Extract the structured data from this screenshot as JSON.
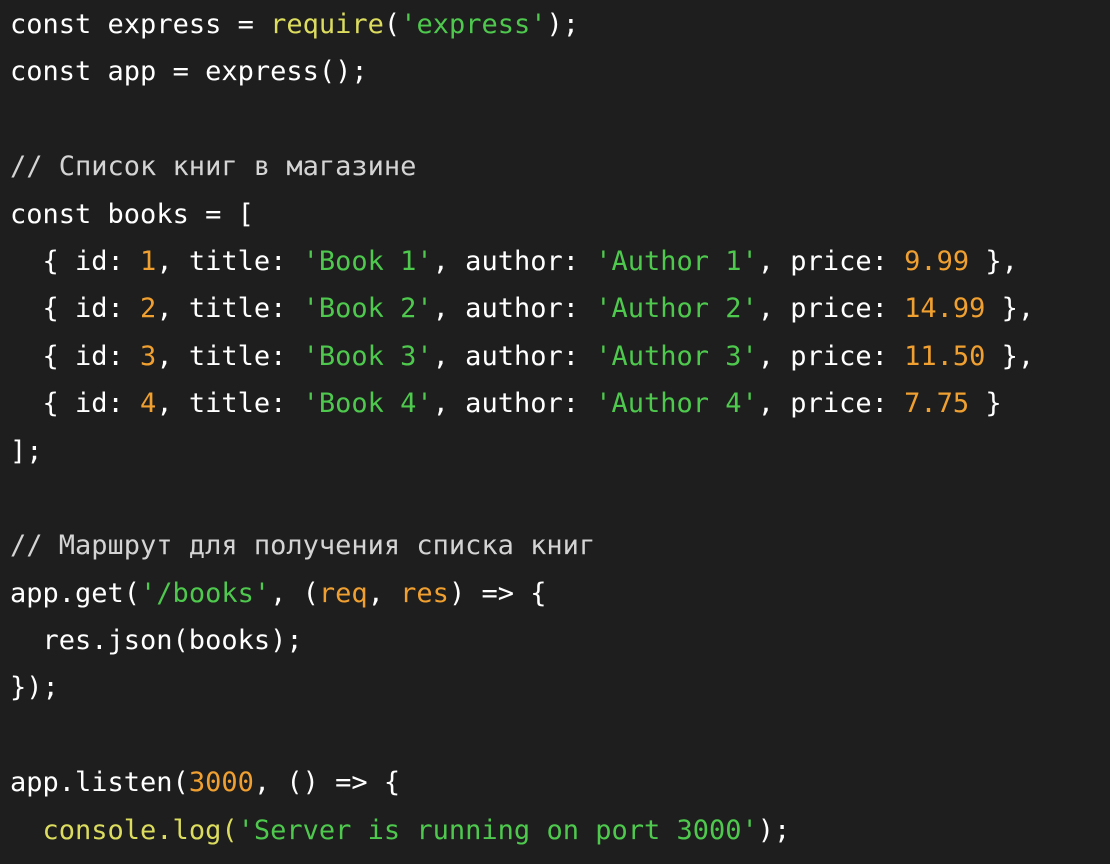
{
  "colors": {
    "background": "#1e1e1e",
    "plain": "#ffffff",
    "keyword": "#ffffff",
    "identifier": "#ffffff",
    "function": "#ffffff",
    "require": "#dcdc5f",
    "string": "#4ec94e",
    "number": "#f0a030",
    "comment": "#d4d4d4",
    "param": "#f0a030",
    "call": "#dcdc5f",
    "punct": "#ffffff"
  },
  "editor": {
    "lines": [
      [
        {
          "text": "const ",
          "type": "keyword"
        },
        {
          "text": "express",
          "type": "identifier"
        },
        {
          "text": " = ",
          "type": "punct"
        },
        {
          "text": "require",
          "type": "require"
        },
        {
          "text": "(",
          "type": "punct"
        },
        {
          "text": "'express'",
          "type": "string"
        },
        {
          "text": ");",
          "type": "punct"
        }
      ],
      [
        {
          "text": "const ",
          "type": "keyword"
        },
        {
          "text": "app",
          "type": "identifier"
        },
        {
          "text": " = ",
          "type": "punct"
        },
        {
          "text": "express",
          "type": "function"
        },
        {
          "text": "();",
          "type": "punct"
        }
      ],
      [],
      [
        {
          "text": "// Список книг в магазине",
          "type": "comment"
        }
      ],
      [
        {
          "text": "const ",
          "type": "keyword"
        },
        {
          "text": "books",
          "type": "identifier"
        },
        {
          "text": " = [",
          "type": "punct"
        }
      ],
      [
        {
          "text": "  { id: ",
          "type": "punct"
        },
        {
          "text": "1",
          "type": "number"
        },
        {
          "text": ", title: ",
          "type": "punct"
        },
        {
          "text": "'Book 1'",
          "type": "string"
        },
        {
          "text": ", author: ",
          "type": "punct"
        },
        {
          "text": "'Author 1'",
          "type": "string"
        },
        {
          "text": ", price: ",
          "type": "punct"
        },
        {
          "text": "9.99",
          "type": "number"
        },
        {
          "text": " },",
          "type": "punct"
        }
      ],
      [
        {
          "text": "  { id: ",
          "type": "punct"
        },
        {
          "text": "2",
          "type": "number"
        },
        {
          "text": ", title: ",
          "type": "punct"
        },
        {
          "text": "'Book 2'",
          "type": "string"
        },
        {
          "text": ", author: ",
          "type": "punct"
        },
        {
          "text": "'Author 2'",
          "type": "string"
        },
        {
          "text": ", price: ",
          "type": "punct"
        },
        {
          "text": "14.99",
          "type": "number"
        },
        {
          "text": " },",
          "type": "punct"
        }
      ],
      [
        {
          "text": "  { id: ",
          "type": "punct"
        },
        {
          "text": "3",
          "type": "number"
        },
        {
          "text": ", title: ",
          "type": "punct"
        },
        {
          "text": "'Book 3'",
          "type": "string"
        },
        {
          "text": ", author: ",
          "type": "punct"
        },
        {
          "text": "'Author 3'",
          "type": "string"
        },
        {
          "text": ", price: ",
          "type": "punct"
        },
        {
          "text": "11.50",
          "type": "number"
        },
        {
          "text": " },",
          "type": "punct"
        }
      ],
      [
        {
          "text": "  { id: ",
          "type": "punct"
        },
        {
          "text": "4",
          "type": "number"
        },
        {
          "text": ", title: ",
          "type": "punct"
        },
        {
          "text": "'Book 4'",
          "type": "string"
        },
        {
          "text": ", author: ",
          "type": "punct"
        },
        {
          "text": "'Author 4'",
          "type": "string"
        },
        {
          "text": ", price: ",
          "type": "punct"
        },
        {
          "text": "7.75",
          "type": "number"
        },
        {
          "text": " }",
          "type": "punct"
        }
      ],
      [
        {
          "text": "];",
          "type": "punct"
        }
      ],
      [],
      [
        {
          "text": "// Маршрут для получения списка книг",
          "type": "comment"
        }
      ],
      [
        {
          "text": "app.get(",
          "type": "punct"
        },
        {
          "text": "'/books'",
          "type": "string"
        },
        {
          "text": ", (",
          "type": "punct"
        },
        {
          "text": "req",
          "type": "param"
        },
        {
          "text": ", ",
          "type": "punct"
        },
        {
          "text": "res",
          "type": "param"
        },
        {
          "text": ") => {",
          "type": "punct"
        }
      ],
      [
        {
          "text": "  res.json(books);",
          "type": "punct"
        }
      ],
      [
        {
          "text": "});",
          "type": "punct"
        }
      ],
      [],
      [
        {
          "text": "app.listen(",
          "type": "punct"
        },
        {
          "text": "3000",
          "type": "number"
        },
        {
          "text": ", () => {",
          "type": "punct"
        }
      ],
      [
        {
          "text": "  ",
          "type": "punct"
        },
        {
          "text": "console.log(",
          "type": "call"
        },
        {
          "text": "'Server is running on port 3000'",
          "type": "string"
        },
        {
          "text": ");",
          "type": "punct"
        }
      ],
      [
        {
          "text": "});",
          "type": "punct"
        }
      ]
    ]
  }
}
